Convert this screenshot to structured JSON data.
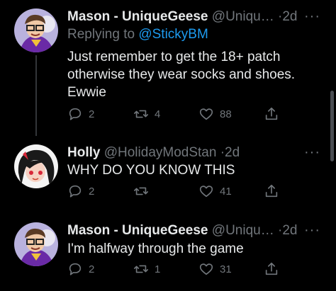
{
  "tweets": [
    {
      "name": "Mason - UniqueGeese",
      "handle": "@Uniqu…",
      "dot": "·",
      "time": "2d",
      "replying_label": "Replying to",
      "replying_mention": "@StickyBM",
      "text": "Just remember to get the 18+ patch otherwise they wear socks and shoes. Ewwie",
      "replies": "2",
      "retweets": "4",
      "likes": "88"
    },
    {
      "name": "Holly",
      "handle": "@HolidayModStan",
      "dot": "·",
      "time": "2d",
      "text": "WHY DO YOU KNOW THIS",
      "replies": "2",
      "retweets": "",
      "likes": "41"
    },
    {
      "name": "Mason - UniqueGeese",
      "handle": "@Uniqu…",
      "dot": "·",
      "time": "2d",
      "text": "I'm halfway through the game",
      "replies": "2",
      "retweets": "1",
      "likes": "31"
    }
  ],
  "more_glyph": "···",
  "colors": {
    "background": "#000000",
    "text": "#e7e9ea",
    "muted": "#71767b",
    "link": "#1d9bf0"
  }
}
